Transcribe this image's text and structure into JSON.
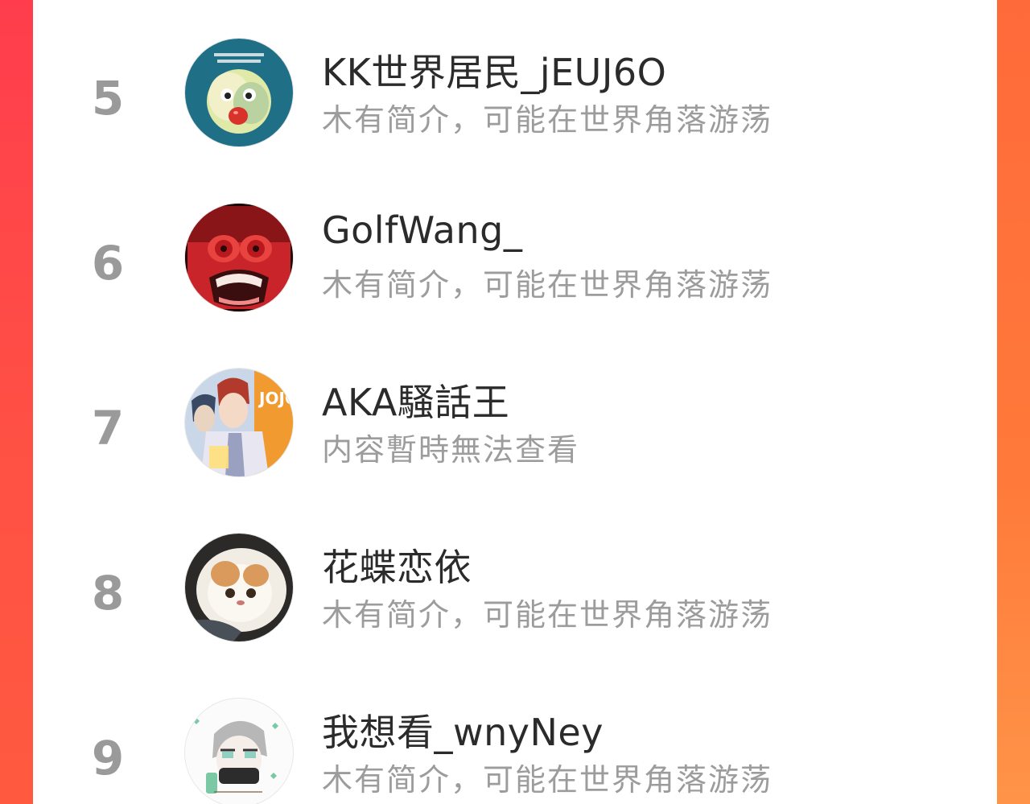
{
  "list": {
    "rows": [
      {
        "rank": "5",
        "name": "KK世界居民_jEUJ6O",
        "bio": "木有简介，可能在世界角落游荡",
        "avatar_icon": "fluffy-monster-avatar-icon"
      },
      {
        "rank": "6",
        "name": "GolfWang_",
        "bio": "木有简介，可能在世界角落游荡",
        "avatar_icon": "angry-cartoon-face-avatar-icon"
      },
      {
        "rank": "7",
        "name": "AKA騷話王",
        "bio": "内容暫時無法查看",
        "avatar_icon": "anime-characters-avatar-icon"
      },
      {
        "rank": "8",
        "name": "花蝶恋依",
        "bio": "木有简介，可能在世界角落游荡",
        "avatar_icon": "fluffy-cat-avatar-icon"
      },
      {
        "rank": "9",
        "name": "我想看_wnyNey",
        "bio": "木有简介，可能在世界角落游荡",
        "avatar_icon": "anime-sketch-avatar-icon"
      }
    ]
  },
  "colors": {
    "background_accent": "#ff5a40",
    "rank_text": "#9a9a9a",
    "name_text": "#2b2b2b",
    "bio_text": "#9c9c9c"
  }
}
